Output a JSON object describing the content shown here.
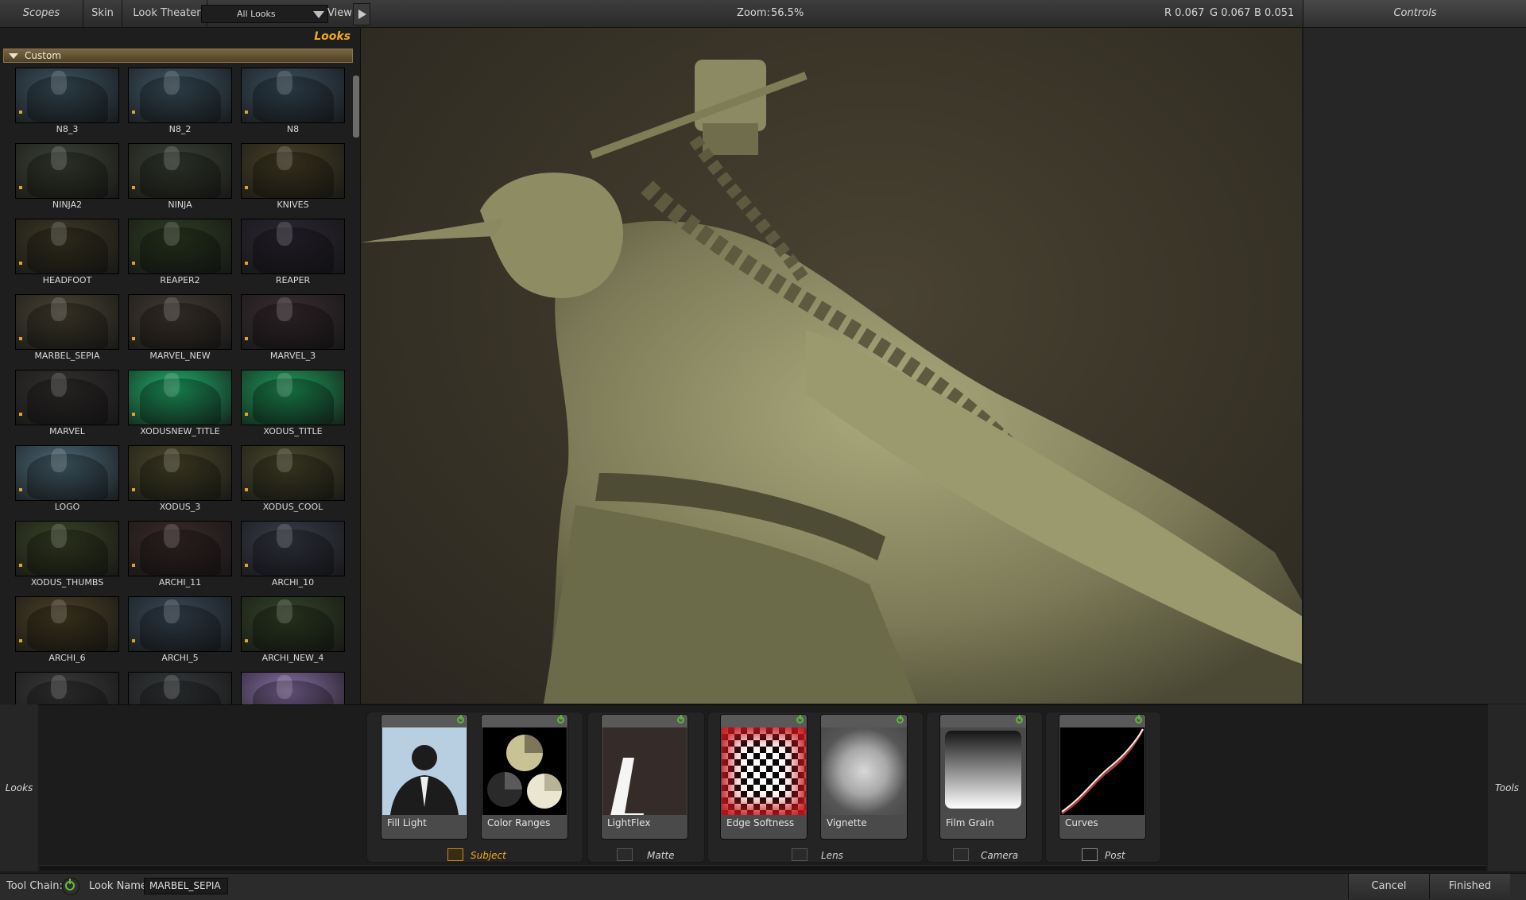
{
  "topbar": {
    "scopes": "Scopes",
    "skin": "Skin",
    "look_theater": "Look Theater",
    "looks_filter": "All Looks",
    "view": "View",
    "zoom_label": "Zoom:",
    "zoom_value": "56.5%",
    "r": "R 0.067",
    "g": "G 0.067",
    "b": "B 0.051",
    "controls": "Controls"
  },
  "left_panel": {
    "header": "Looks",
    "category": "Custom",
    "thumbs": [
      {
        "label": "N8_3",
        "color": "#3d5563"
      },
      {
        "label": "N8_2",
        "color": "#3f5766"
      },
      {
        "label": "N8",
        "color": "#3a5060"
      },
      {
        "label": "NINJA2",
        "color": "#3d4434"
      },
      {
        "label": "NINJA",
        "color": "#3b4335"
      },
      {
        "label": "KNIVES",
        "color": "#4a4226"
      },
      {
        "label": "HEADFOOT",
        "color": "#3e3a25"
      },
      {
        "label": "REAPER2",
        "color": "#2e3d22"
      },
      {
        "label": "REAPER",
        "color": "#2c2733"
      },
      {
        "label": "MARBEL_SEPIA",
        "color": "#4a4433"
      },
      {
        "label": "MARVEL_NEW",
        "color": "#443b33"
      },
      {
        "label": "MARVEL_3",
        "color": "#3a2e33"
      },
      {
        "label": "MARVEL",
        "color": "#34302f"
      },
      {
        "label": "XODUSNEW_TITLE",
        "color": "#1fb06a"
      },
      {
        "label": "XODUS_TITLE",
        "color": "#1e9c5a"
      },
      {
        "label": "LOGO",
        "color": "#4c6a79"
      },
      {
        "label": "XODUS_3",
        "color": "#4d4a2a"
      },
      {
        "label": "XODUS_COOL",
        "color": "#4c4a2b"
      },
      {
        "label": "XODUS_THUMBS",
        "color": "#3b4526"
      },
      {
        "label": "ARCHI_11",
        "color": "#3c2a2a"
      },
      {
        "label": "ARCHI_10",
        "color": "#3a3d4c"
      },
      {
        "label": "ARCHI_6",
        "color": "#4b4124"
      },
      {
        "label": "ARCHI_5",
        "color": "#3a4a5a"
      },
      {
        "label": "ARCHI_NEW_4",
        "color": "#344527"
      },
      {
        "label": "",
        "color": "#3a3a3a"
      },
      {
        "label": "",
        "color": "#363a3d"
      },
      {
        "label": "",
        "color": "#8a70a8"
      }
    ]
  },
  "tools": {
    "side_left": "Looks",
    "side_right": "Tools",
    "cards": [
      {
        "label": "Fill Light",
        "icon": "silhouette-icon"
      },
      {
        "label": "Color Ranges",
        "icon": "color-ranges-icon"
      },
      {
        "label": "LightFlex",
        "icon": "lightflex-icon"
      },
      {
        "label": "Edge Softness",
        "icon": "checker-icon"
      },
      {
        "label": "Vignette",
        "icon": "vignette-icon"
      },
      {
        "label": "Film Grain",
        "icon": "film-grain-icon"
      },
      {
        "label": "Curves",
        "icon": "curves-icon"
      }
    ],
    "groups": [
      "Subject",
      "Matte",
      "Lens",
      "Camera",
      "Post"
    ]
  },
  "statusbar": {
    "tool_chain": "Tool Chain:",
    "look_name_label": "Look Name:",
    "look_name_value": "MARBEL_SEPIA",
    "cancel": "Cancel",
    "finished": "Finished"
  },
  "colors": {
    "accent": "#f2a81d",
    "power_on": "#5fb536"
  }
}
